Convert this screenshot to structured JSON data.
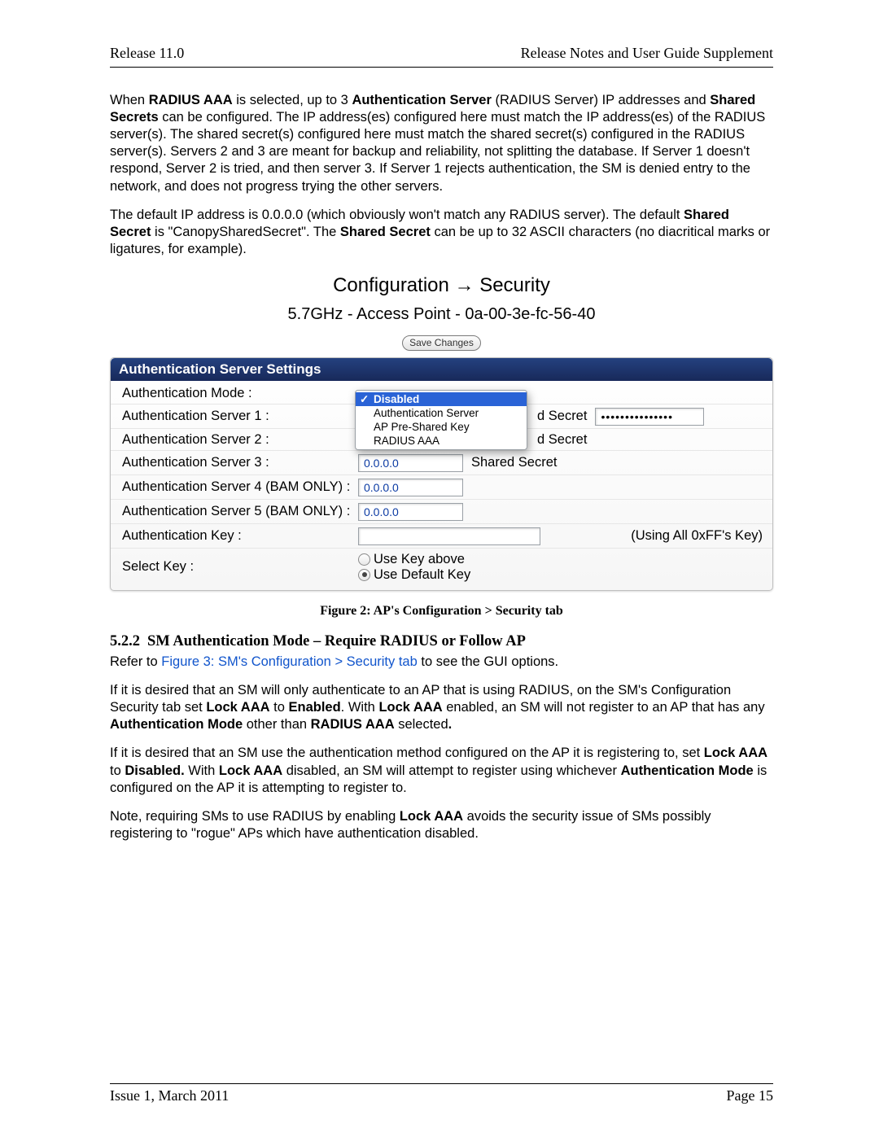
{
  "header": {
    "left": "Release 11.0",
    "right": "Release Notes and User Guide Supplement"
  },
  "footer": {
    "left": "Issue 1, March 2011",
    "right": "Page 15"
  },
  "intro": {
    "p1_a": "When ",
    "p1_b": "RADIUS AAA",
    "p1_c": " is selected, up to 3 ",
    "p1_d": "Authentication Server",
    "p1_e": " (RADIUS Server) IP addresses and ",
    "p1_f": "Shared Secrets",
    "p1_g": " can be configured. The IP address(es) configured here must match the IP address(es) of the RADIUS server(s). The shared secret(s) configured here must match the shared secret(s) configured in the RADIUS server(s). Servers 2 and 3 are meant for backup and reliability, not splitting the database. If Server 1 doesn't respond, Server 2 is tried, and then server 3. If Server 1 rejects authentication, the SM is denied entry to the network, and does not progress trying the other servers.",
    "p2_a": "The default IP address is 0.0.0.0 (which obviously won't match any RADIUS server). The default ",
    "p2_b": "Shared Secret",
    "p2_c": " is \"CanopySharedSecret\". The ",
    "p2_d": "Shared Secret",
    "p2_e": " can be up to 32 ASCII characters (no diacritical marks or ligatures, for example)."
  },
  "figure": {
    "title_a": "Configuration",
    "title_arrow": "→",
    "title_b": "Security",
    "subtitle": "5.7GHz - Access Point - 0a-00-3e-fc-56-40",
    "save": "Save Changes",
    "panel_head": "Authentication Server Settings",
    "labels": {
      "mode": "Authentication Mode :",
      "s1": "Authentication Server 1 :",
      "s2": "Authentication Server 2 :",
      "s3": "Authentication Server 3 :",
      "s4": "Authentication Server 4 (BAM ONLY) :",
      "s5": "Authentication Server 5 (BAM ONLY) :",
      "key": "Authentication Key :",
      "select": "Select Key :"
    },
    "menu": {
      "opt1": "Disabled",
      "opt2": "Authentication Server",
      "opt3": "AP Pre-Shared Key",
      "opt4": "RADIUS AAA"
    },
    "ss_partial_1": "d Secret",
    "ss_partial_2": "d Secret",
    "ss_full": "Shared Secret",
    "ss_value": "•••••••••••••••",
    "ip_default": "0.0.0.0",
    "key_note": "(Using All 0xFF's Key)",
    "radio_a": "Use Key above",
    "radio_b": "Use Default Key",
    "caption": "Figure 2: AP's Configuration > Security tab"
  },
  "section": {
    "num": "5.2.2",
    "title": "SM Authentication Mode – Require RADIUS or Follow AP",
    "refer_a": "Refer to ",
    "refer_link": "Figure 3: SM's Configuration > Security tab",
    "refer_b": " to see the GUI options.",
    "p1_a": "If it is desired that an SM will only authenticate to an AP that is using RADIUS, on the SM's Configuration Security tab set ",
    "p1_b": "Lock AAA",
    "p1_c": "  to ",
    "p1_d": "Enabled",
    "p1_e": ". With ",
    "p1_f": "Lock AAA",
    "p1_g": " enabled, an SM will not register to an AP that has any ",
    "p1_h": "Authentication Mode",
    "p1_i": " other than ",
    "p1_j": "RADIUS AAA",
    "p1_k": " selected",
    "p1_l": ".",
    "p2_a": "If it is desired that an SM use the authentication method configured on the AP it is registering to, set ",
    "p2_b": "Lock AAA",
    "p2_c": " to ",
    "p2_d": "Disabled.",
    "p2_e": " With ",
    "p2_f": "Lock AAA",
    "p2_g": " disabled, an SM will attempt to register using whichever ",
    "p2_h": "Authentication Mode",
    "p2_i": " is configured on the AP it is attempting to register to.",
    "p3_a": "Note, requiring SMs to use RADIUS by enabling ",
    "p3_b": "Lock AAA",
    "p3_c": " avoids the security issue of SMs possibly registering to \"rogue\" APs which have authentication disabled."
  }
}
